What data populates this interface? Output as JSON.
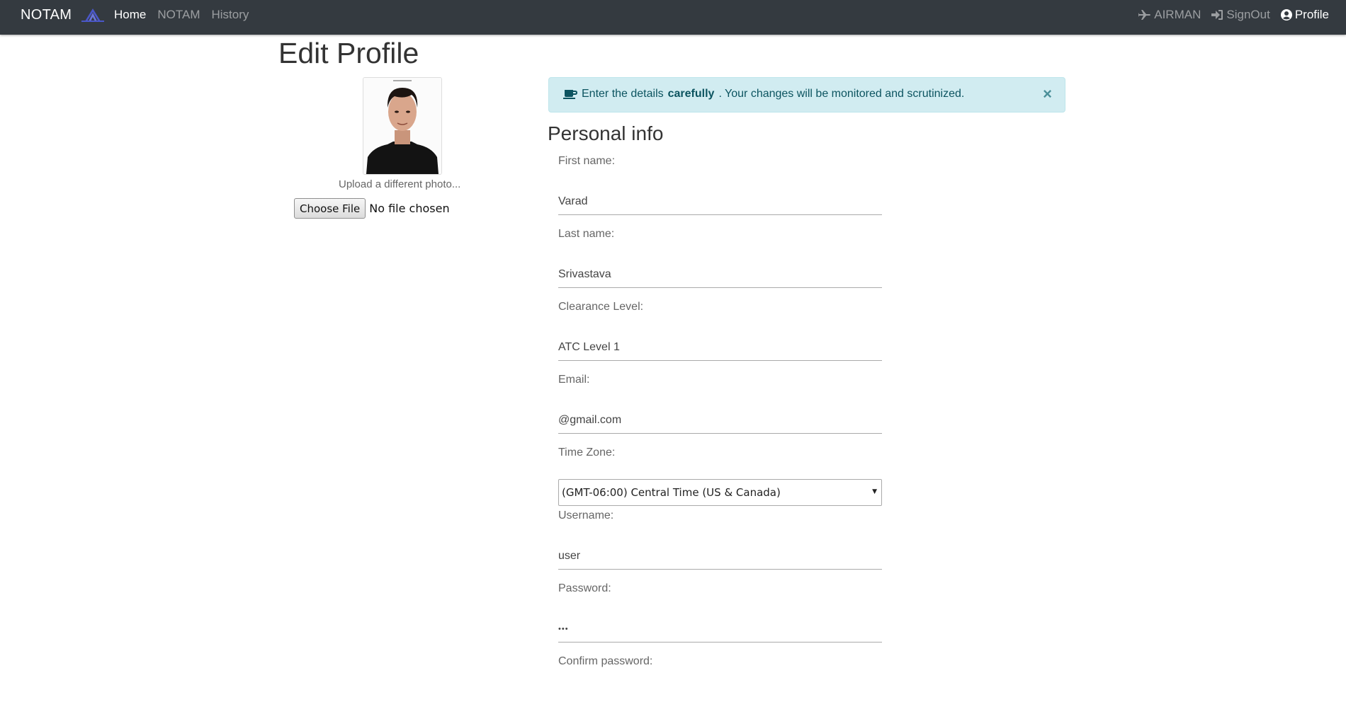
{
  "nav": {
    "brand": "NOTAM",
    "left_links": [
      {
        "label": "Home"
      },
      {
        "label": "NOTAM"
      },
      {
        "label": "History"
      }
    ],
    "right_links": [
      {
        "label": "AIRMAN",
        "icon": "plane-icon"
      },
      {
        "label": "SignOut",
        "icon": "sign-in-icon"
      },
      {
        "label": "Profile",
        "icon": "user-circle-icon"
      }
    ]
  },
  "page": {
    "title": "Edit Profile"
  },
  "photo": {
    "upload_label": "Upload a different photo...",
    "choose_button": "Choose File",
    "file_status": "No file chosen"
  },
  "alert": {
    "prefix": "Enter the details",
    "emphasis": "carefully",
    "suffix": ". Your changes will be monitored and scrutinized.",
    "close": "×",
    "icon": "coffee-icon"
  },
  "form": {
    "section_title": "Personal info",
    "first_name": {
      "label": "First name:",
      "value": "Varad"
    },
    "last_name": {
      "label": "Last name:",
      "value": "Srivastava"
    },
    "clearance": {
      "label": "Clearance Level:",
      "value": "ATC Level 1"
    },
    "email": {
      "label": "Email:",
      "value": "@gmail.com"
    },
    "timezone": {
      "label": "Time Zone:",
      "value": "(GMT-06:00) Central Time (US & Canada)"
    },
    "username": {
      "label": "Username:",
      "value": "user"
    },
    "password": {
      "label": "Password:",
      "value": "•••"
    },
    "confirm": {
      "label": "Confirm password:"
    }
  },
  "colors": {
    "navbar": "#343a40",
    "alert_bg": "#d1ecf1",
    "alert_text": "#0c5460",
    "logo": "#4455bb"
  }
}
